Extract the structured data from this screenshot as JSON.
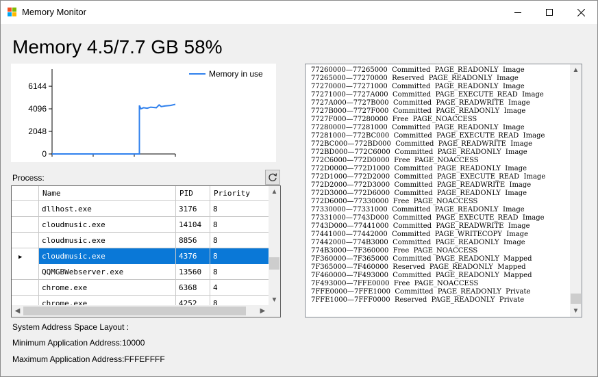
{
  "window": {
    "title": "Memory Monitor",
    "minimize_icon": "minimize-icon",
    "maximize_icon": "maximize-icon",
    "close_icon": "close-icon"
  },
  "heading": "Memory 4.5/7.7 GB 58%",
  "colors": {
    "line": "#2f80ed",
    "selection": "#0a78d7"
  },
  "chart_data": {
    "type": "line",
    "series": [
      {
        "name": "Memory in use",
        "color": "#2f80ed",
        "points": [
          [
            0,
            0
          ],
          [
            40,
            0
          ],
          [
            75,
            0
          ],
          [
            110,
            0
          ],
          [
            124,
            0
          ],
          [
            124,
            4400
          ],
          [
            126,
            4100
          ],
          [
            130,
            4200
          ],
          [
            135,
            4150
          ],
          [
            140,
            4250
          ],
          [
            148,
            4200
          ],
          [
            152,
            4450
          ],
          [
            155,
            4300
          ],
          [
            160,
            4350
          ],
          [
            168,
            4400
          ],
          [
            175,
            4500
          ]
        ]
      }
    ],
    "yticks": [
      0,
      2048,
      4096,
      6144
    ],
    "xlim": [
      0,
      175
    ],
    "ylim": [
      0,
      7700
    ],
    "grid": false,
    "legend_position": "top-right"
  },
  "process": {
    "label": "Process:",
    "refresh_icon": "refresh-icon",
    "columns": [
      "Name",
      "PID",
      "Priority"
    ],
    "rows": [
      {
        "name": "dllhost.exe",
        "pid": "3176",
        "priority": "8"
      },
      {
        "name": "cloudmusic.exe",
        "pid": "14104",
        "priority": "8"
      },
      {
        "name": "cloudmusic.exe",
        "pid": "8856",
        "priority": "8"
      },
      {
        "name": "cloudmusic.exe",
        "pid": "4376",
        "priority": "8",
        "selected": true
      },
      {
        "name": "QQMGBWebserver.exe",
        "pid": "13560",
        "priority": "8"
      },
      {
        "name": "chrome.exe",
        "pid": "6368",
        "priority": "4"
      },
      {
        "name": "chrome.exe",
        "pid": "4252",
        "priority": "8"
      }
    ]
  },
  "layout_info": {
    "title": "System Address Space Layout :",
    "min_address": "Minimum Application Address:10000",
    "max_address": "Maximum Application Address:FFFEFFFF"
  },
  "regions": [
    "77260000—77265000  Committed  PAGE_READONLY  Image",
    "77265000—77270000  Reserved  PAGE_READONLY  Image",
    "77270000—77271000  Committed  PAGE_READONLY  Image",
    "77271000—7727A000  Committed  PAGE_EXECUTE_READ  Image",
    "7727A000—7727B000  Committed  PAGE_READWRITE  Image",
    "7727B000—7727F000  Committed  PAGE_READONLY  Image",
    "7727F000—77280000  Free  PAGE_NOACCESS",
    "77280000—77281000  Committed  PAGE_READONLY  Image",
    "77281000—772BC000  Committed  PAGE_EXECUTE_READ  Image",
    "772BC000—772BD000  Committed  PAGE_READWRITE  Image",
    "772BD000—772C6000  Committed  PAGE_READONLY  Image",
    "772C6000—772D0000  Free  PAGE_NOACCESS",
    "772D0000—772D1000  Committed  PAGE_READONLY  Image",
    "772D1000—772D2000  Committed  PAGE_EXECUTE_READ  Image",
    "772D2000—772D3000  Committed  PAGE_READWRITE  Image",
    "772D3000—772D6000  Committed  PAGE_READONLY  Image",
    "772D6000—77330000  Free  PAGE_NOACCESS",
    "77330000—77331000  Committed  PAGE_READONLY  Image",
    "77331000—7743D000  Committed  PAGE_EXECUTE_READ  Image",
    "7743D000—77441000  Committed  PAGE_READWRITE  Image",
    "77441000—77442000  Committed  PAGE_WRITECOPY  Image",
    "77442000—774B3000  Committed  PAGE_READONLY  Image",
    "774B3000—7F360000  Free  PAGE_NOACCESS",
    "7F360000—7F365000  Committed  PAGE_READONLY  Mapped",
    "7F365000—7F460000  Reserved  PAGE_READONLY  Mapped",
    "7F460000—7F493000  Committed  PAGE_READONLY  Mapped",
    "7F493000—7FFE0000  Free  PAGE_NOACCESS",
    "7FFE0000—7FFE1000  Committed  PAGE_READONLY  Private",
    "7FFE1000—7FFF0000  Reserved  PAGE_READONLY  Private"
  ]
}
